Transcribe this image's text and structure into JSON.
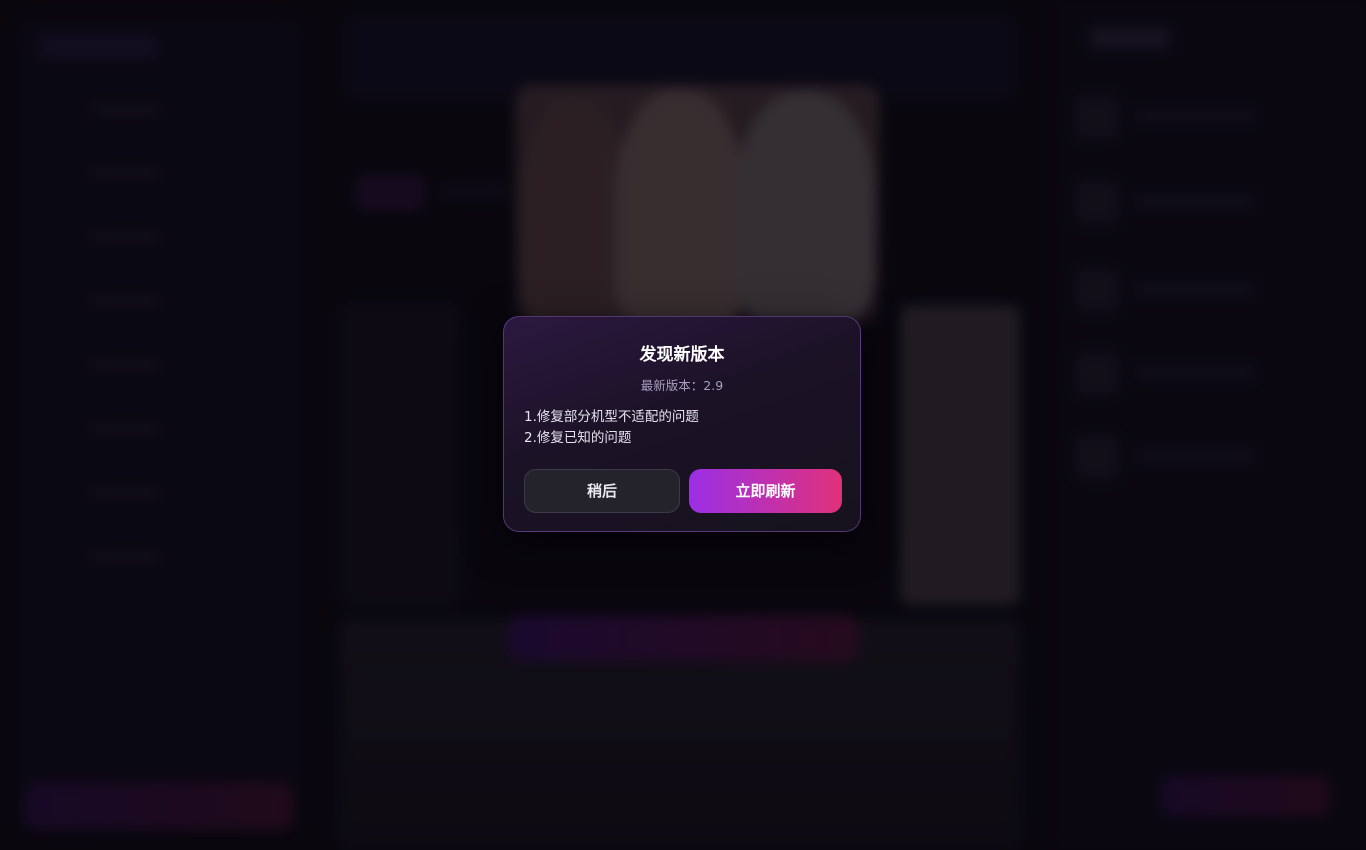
{
  "dialog": {
    "title": "发现新版本",
    "version": "最新版本：2.9",
    "notes": [
      "1.修复部分机型不适配的问题",
      "2.修复已知的问题"
    ],
    "later_label": "稍后",
    "refresh_label": "立即刷新"
  },
  "colors": {
    "accent_start": "#9b2fe6",
    "accent_end": "#e0317a",
    "background": "#0b0912"
  }
}
